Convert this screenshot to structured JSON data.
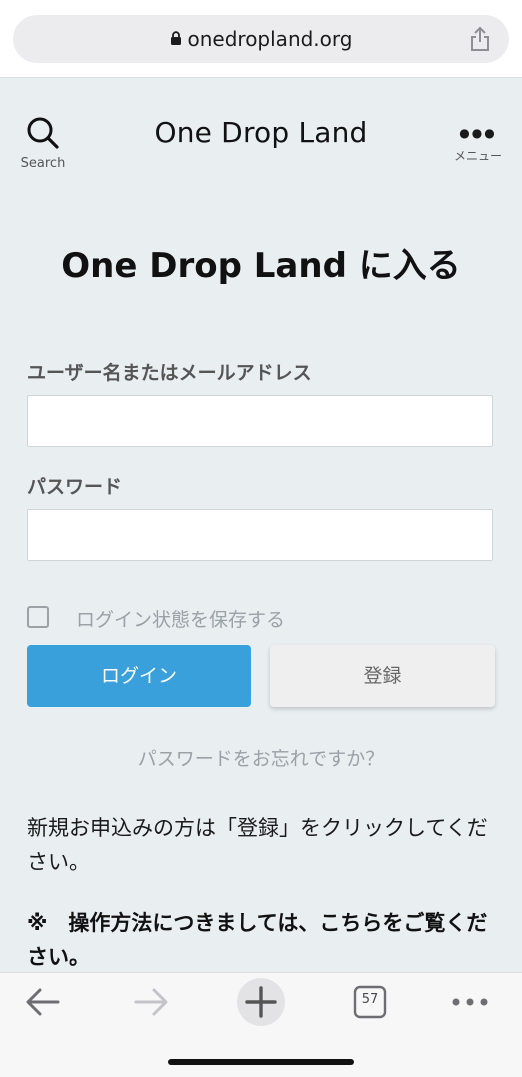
{
  "browser": {
    "url": "onedropland.org",
    "icons": {
      "lock": "lock-icon",
      "share": "share-icon"
    }
  },
  "header": {
    "search_label": "Search",
    "site_title": "One Drop Land",
    "menu_label": "メニュー",
    "menu_dots": "●●●"
  },
  "login": {
    "title": "One Drop Land に入る",
    "username_label": "ユーザー名またはメールアドレス",
    "username_value": "",
    "password_label": "パスワード",
    "password_value": "",
    "remember_label": "ログイン状態を保存する",
    "remember_checked": false,
    "login_button": "ログイン",
    "register_button": "登録",
    "forgot_link": "パスワードをお忘れですか？"
  },
  "content": {
    "paragraph": "新規お申込みの方は「登録」をクリックしてください。",
    "note": "※　操作方法につきましては、こちらをご覧ください。"
  },
  "toolbar": {
    "tab_count": "57",
    "items": [
      "back-arrow-icon",
      "forward-arrow-icon",
      "new-tab-plus-icon",
      "tabs-icon",
      "more-icon"
    ]
  },
  "colors": {
    "page_bg": "#e9eef1",
    "primary": "#3aa0dc",
    "muted": "#9aa1a7"
  }
}
